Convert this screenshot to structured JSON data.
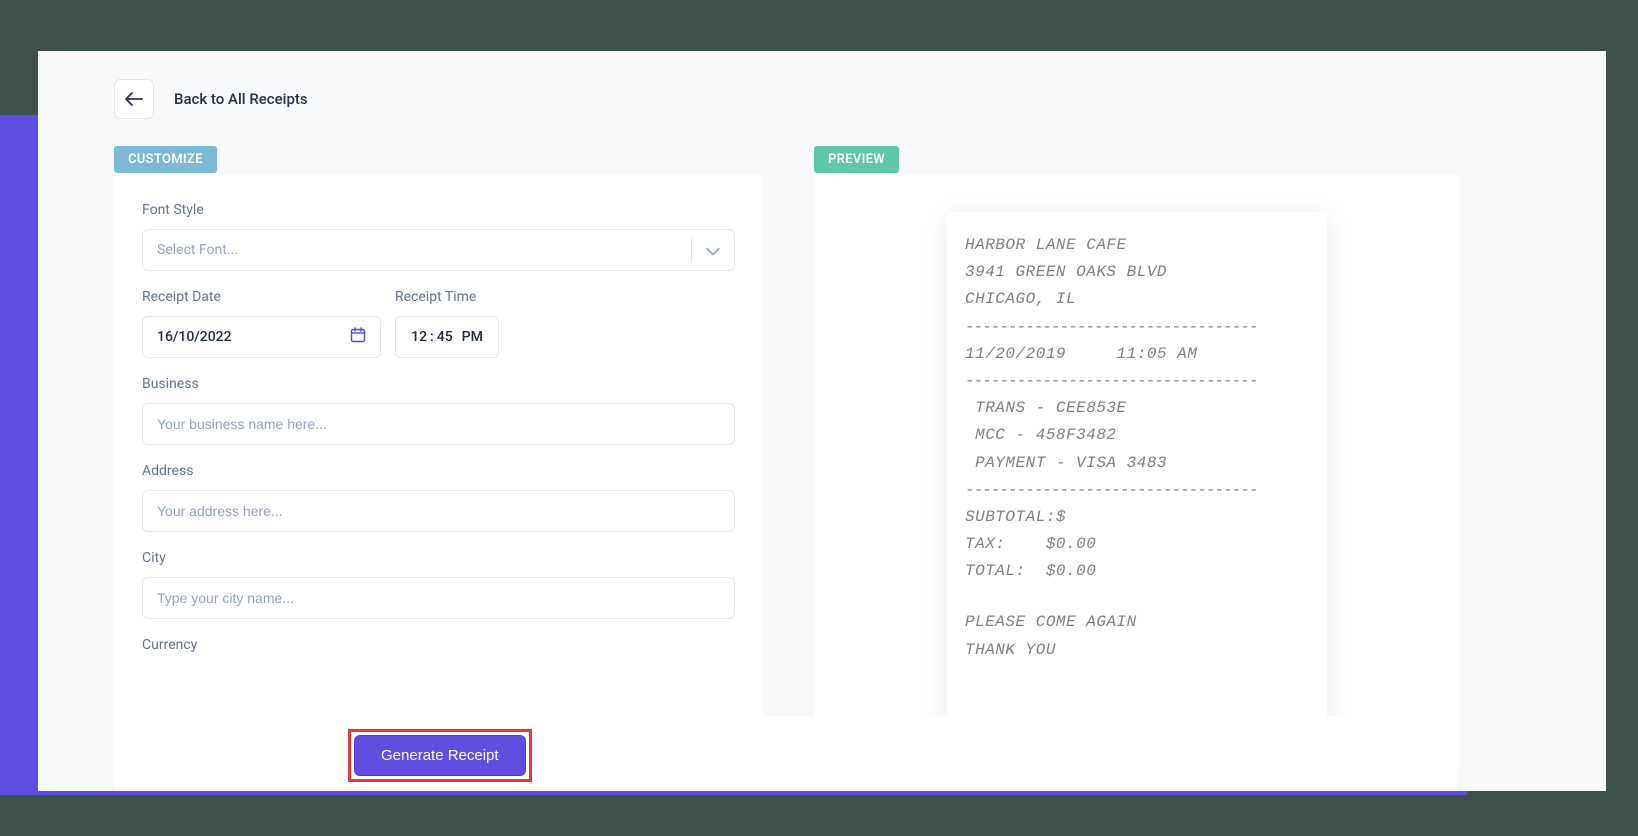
{
  "back": {
    "label": "Back to All Receipts"
  },
  "badges": {
    "customize": "CUSTOMIZE",
    "preview": "PREVIEW"
  },
  "customize": {
    "fontStyle": {
      "label": "Font Style",
      "placeholder": "Select Font..."
    },
    "receiptDate": {
      "label": "Receipt Date",
      "value": "16/10/2022"
    },
    "receiptTime": {
      "label": "Receipt Time",
      "hour": "12",
      "minute": "45",
      "ampm": "PM"
    },
    "business": {
      "label": "Business",
      "placeholder": "Your business name here..."
    },
    "address": {
      "label": "Address",
      "placeholder": "Your address here..."
    },
    "city": {
      "label": "City",
      "placeholder": "Type your city name..."
    },
    "currency": {
      "label": "Currency"
    }
  },
  "generate": {
    "label": "Generate Receipt"
  },
  "receipt": {
    "name": "HARBOR LANE CAFE",
    "address": "3941 GREEN OAKS BLVD",
    "city": "CHICAGO, IL",
    "dateTimeRow": "11/20/2019     11:05 AM",
    "transRow": " TRANS - CEE853E",
    "mccRow": " MCC - 458F3482",
    "paymentRow": " PAYMENT - VISA 3483",
    "subtotalRow": "SUBTOTAL:$",
    "taxRow": "TAX:    $0.00",
    "totalRow": "TOTAL:  $0.00",
    "footer1": "PLEASE COME AGAIN",
    "footer2": "THANK YOU"
  }
}
